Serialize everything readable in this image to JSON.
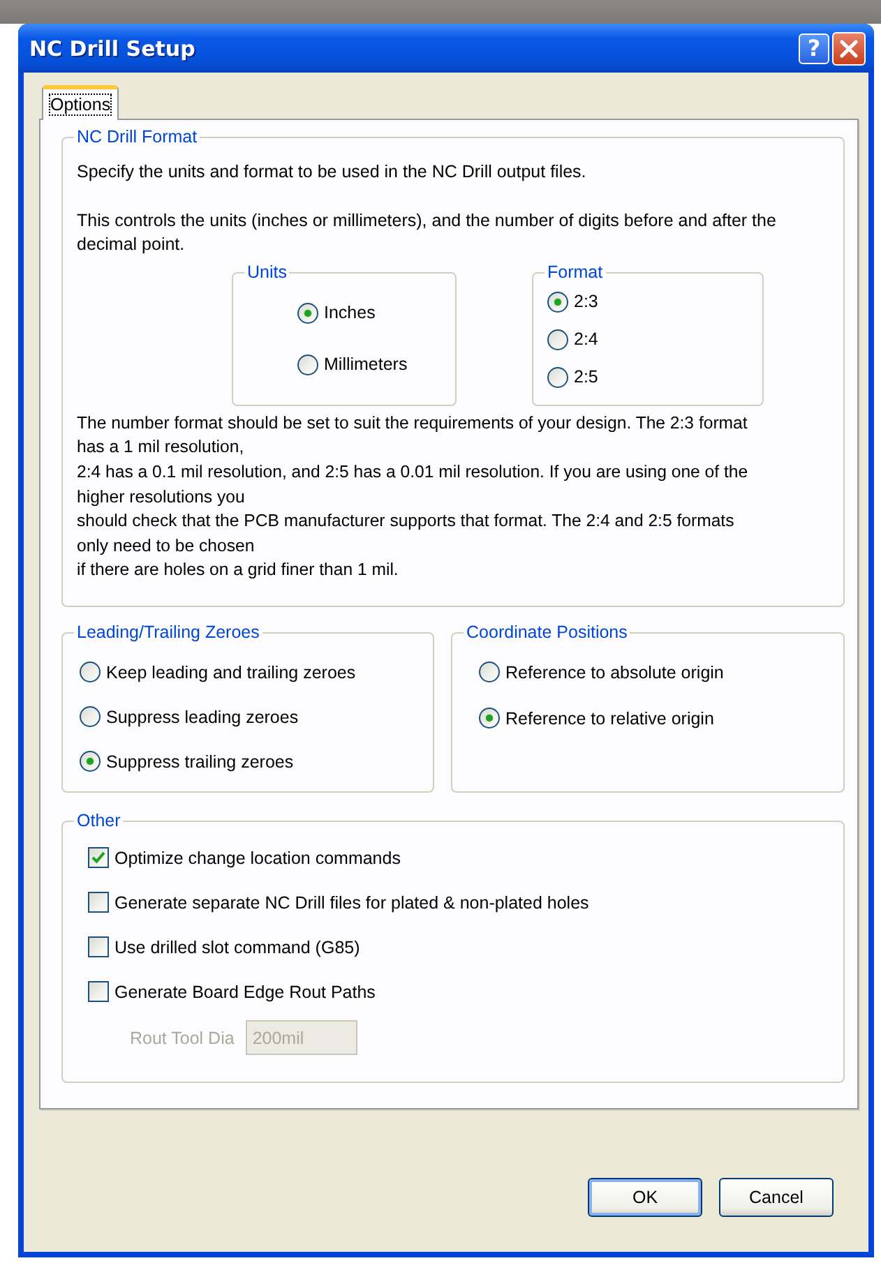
{
  "window": {
    "title": "NC Drill Setup",
    "help_button": "?"
  },
  "tabs": [
    {
      "label": "Options",
      "selected": true
    }
  ],
  "nc_drill_format": {
    "title": "NC Drill Format",
    "intro": "Specify the units and format to be used in the NC Drill output files.",
    "detail": "This controls the units (inches or millimeters), and the number of digits before and after the decimal point.",
    "units": {
      "title": "Units",
      "options": [
        {
          "label": "Inches",
          "selected": true
        },
        {
          "label": "Millimeters",
          "selected": false
        }
      ]
    },
    "format": {
      "title": "Format",
      "options": [
        {
          "label": "2:3",
          "selected": true
        },
        {
          "label": "2:4",
          "selected": false
        },
        {
          "label": "2:5",
          "selected": false
        }
      ]
    },
    "note": "The number format should be set to suit the requirements of your design. The 2:3 format\nhas a 1 mil resolution,\n2:4 has a 0.1 mil resolution, and 2:5 has a 0.01 mil resolution. If you are using one of the\nhigher resolutions you\nshould check that the PCB manufacturer supports that format. The 2:4 and 2:5 formats\nonly need to be chosen\nif there are holes on a grid finer than 1 mil."
  },
  "leading_trailing_zeroes": {
    "title": "Leading/Trailing Zeroes",
    "options": [
      {
        "label": "Keep leading and trailing zeroes",
        "selected": false
      },
      {
        "label": "Suppress leading zeroes",
        "selected": false
      },
      {
        "label": "Suppress trailing zeroes",
        "selected": true
      }
    ]
  },
  "coordinate_positions": {
    "title": "Coordinate Positions",
    "options": [
      {
        "label": "Reference to absolute origin",
        "selected": false
      },
      {
        "label": "Reference to relative origin",
        "selected": true
      }
    ]
  },
  "other": {
    "title": "Other",
    "options": [
      {
        "label": "Optimize change location commands",
        "checked": true
      },
      {
        "label": "Generate separate NC Drill files for plated & non-plated holes",
        "checked": false
      },
      {
        "label": "Use drilled slot command (G85)",
        "checked": false
      },
      {
        "label": "Generate Board Edge Rout Paths",
        "checked": false
      }
    ],
    "rout_tool_dia": {
      "label": "Rout Tool Dia",
      "value": "200mil",
      "disabled": true
    }
  },
  "buttons": [
    {
      "label": "OK",
      "default": true
    },
    {
      "label": "Cancel",
      "default": false
    }
  ]
}
